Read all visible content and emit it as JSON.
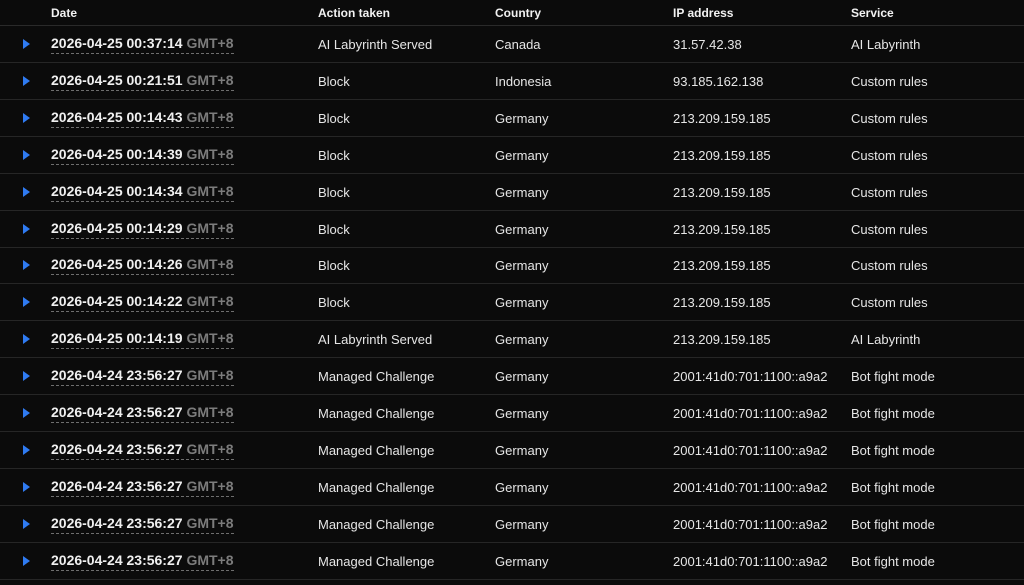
{
  "columns": {
    "date": "Date",
    "action": "Action taken",
    "country": "Country",
    "ip": "IP address",
    "service": "Service"
  },
  "colors": {
    "accent": "#2f7bf2",
    "background": "#0b0b0b",
    "row_border": "#262626",
    "timezone_text": "#7c7c7c"
  },
  "icons": {
    "expander": "caret-right-icon"
  },
  "rows": [
    {
      "datetime": "2026-04-25 00:37:14",
      "tz": "GMT+8",
      "action": "AI Labyrinth Served",
      "country": "Canada",
      "ip": "31.57.42.38",
      "service": "AI Labyrinth"
    },
    {
      "datetime": "2026-04-25 00:21:51",
      "tz": "GMT+8",
      "action": "Block",
      "country": "Indonesia",
      "ip": "93.185.162.138",
      "service": "Custom rules"
    },
    {
      "datetime": "2026-04-25 00:14:43",
      "tz": "GMT+8",
      "action": "Block",
      "country": "Germany",
      "ip": "213.209.159.185",
      "service": "Custom rules"
    },
    {
      "datetime": "2026-04-25 00:14:39",
      "tz": "GMT+8",
      "action": "Block",
      "country": "Germany",
      "ip": "213.209.159.185",
      "service": "Custom rules"
    },
    {
      "datetime": "2026-04-25 00:14:34",
      "tz": "GMT+8",
      "action": "Block",
      "country": "Germany",
      "ip": "213.209.159.185",
      "service": "Custom rules"
    },
    {
      "datetime": "2026-04-25 00:14:29",
      "tz": "GMT+8",
      "action": "Block",
      "country": "Germany",
      "ip": "213.209.159.185",
      "service": "Custom rules"
    },
    {
      "datetime": "2026-04-25 00:14:26",
      "tz": "GMT+8",
      "action": "Block",
      "country": "Germany",
      "ip": "213.209.159.185",
      "service": "Custom rules"
    },
    {
      "datetime": "2026-04-25 00:14:22",
      "tz": "GMT+8",
      "action": "Block",
      "country": "Germany",
      "ip": "213.209.159.185",
      "service": "Custom rules"
    },
    {
      "datetime": "2026-04-25 00:14:19",
      "tz": "GMT+8",
      "action": "AI Labyrinth Served",
      "country": "Germany",
      "ip": "213.209.159.185",
      "service": "AI Labyrinth"
    },
    {
      "datetime": "2026-04-24 23:56:27",
      "tz": "GMT+8",
      "action": "Managed Challenge",
      "country": "Germany",
      "ip": "2001:41d0:701:1100::a9a2",
      "service": "Bot fight mode"
    },
    {
      "datetime": "2026-04-24 23:56:27",
      "tz": "GMT+8",
      "action": "Managed Challenge",
      "country": "Germany",
      "ip": "2001:41d0:701:1100::a9a2",
      "service": "Bot fight mode"
    },
    {
      "datetime": "2026-04-24 23:56:27",
      "tz": "GMT+8",
      "action": "Managed Challenge",
      "country": "Germany",
      "ip": "2001:41d0:701:1100::a9a2",
      "service": "Bot fight mode"
    },
    {
      "datetime": "2026-04-24 23:56:27",
      "tz": "GMT+8",
      "action": "Managed Challenge",
      "country": "Germany",
      "ip": "2001:41d0:701:1100::a9a2",
      "service": "Bot fight mode"
    },
    {
      "datetime": "2026-04-24 23:56:27",
      "tz": "GMT+8",
      "action": "Managed Challenge",
      "country": "Germany",
      "ip": "2001:41d0:701:1100::a9a2",
      "service": "Bot fight mode"
    },
    {
      "datetime": "2026-04-24 23:56:27",
      "tz": "GMT+8",
      "action": "Managed Challenge",
      "country": "Germany",
      "ip": "2001:41d0:701:1100::a9a2",
      "service": "Bot fight mode"
    }
  ]
}
